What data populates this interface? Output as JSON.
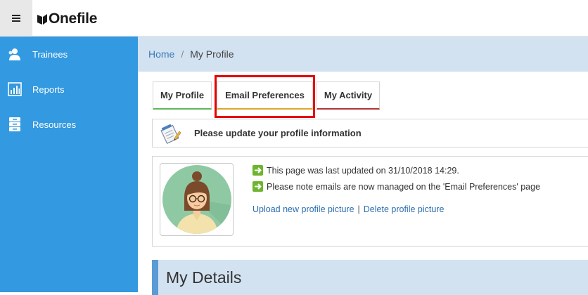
{
  "header": {
    "logo_text": "Onefile",
    "menu_icon": "hamburger-icon"
  },
  "sidebar": {
    "items": [
      {
        "label": "Trainees",
        "icon": "trainees-icon"
      },
      {
        "label": "Reports",
        "icon": "reports-chart-icon"
      },
      {
        "label": "Resources",
        "icon": "resources-cabinet-icon"
      }
    ]
  },
  "breadcrumb": {
    "home": "Home",
    "separator": "/",
    "current": "My Profile"
  },
  "tabs": [
    {
      "label": "My Profile"
    },
    {
      "label": "Email Preferences"
    },
    {
      "label": "My Activity"
    }
  ],
  "notice": {
    "text": "Please update your profile information",
    "icon": "notepad-pencil-icon"
  },
  "profile": {
    "last_updated": "This page was last updated on 31/10/2018 14:29.",
    "email_note": "Please note emails are now managed on the 'Email Preferences' page",
    "upload_link": "Upload new profile picture",
    "link_separator": "|",
    "delete_link": "Delete profile picture"
  },
  "details": {
    "title": "My Details"
  },
  "colors": {
    "sidebar_bg": "#3399e0",
    "breadcrumb_bg": "#d3e2f1",
    "highlight": "#e60000",
    "tab_profile_accent": "#5cb85c",
    "tab_email_accent": "#e1a52c",
    "tab_activity_accent": "#b33434",
    "arrow_green": "#6cb52d"
  }
}
